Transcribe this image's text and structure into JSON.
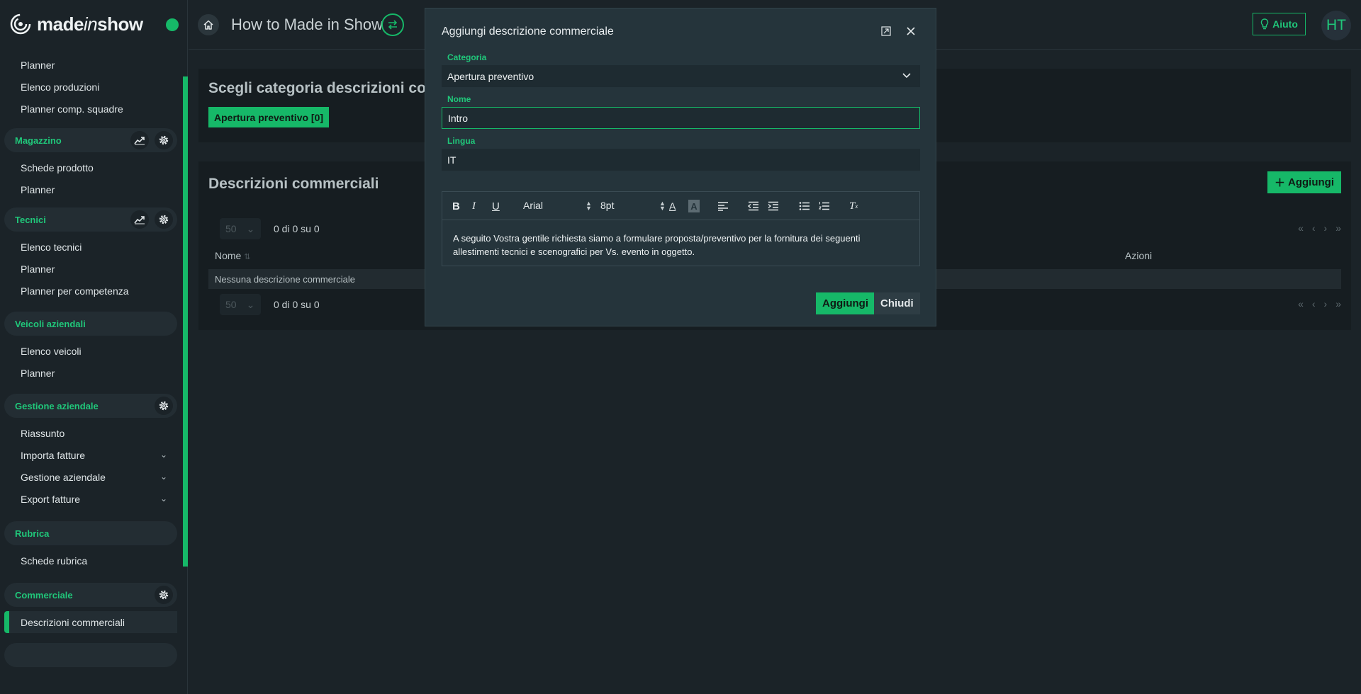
{
  "app": {
    "brand_strong": "made",
    "brand_italic": "in",
    "brand_rest": "show",
    "page_title": "How to Made in Show",
    "help_label": "Aiuto",
    "avatar_initials": "HT",
    "accent_color": "#16b868"
  },
  "sidebar": {
    "top_items": [
      "Planner",
      "Elenco produzioni",
      "Planner comp. squadre"
    ],
    "magazzino": {
      "title": "Magazzino",
      "items": [
        "Schede prodotto",
        "Planner"
      ]
    },
    "tecnici": {
      "title": "Tecnici",
      "items": [
        "Elenco tecnici",
        "Planner",
        "Planner per competenza"
      ]
    },
    "veicoli": {
      "title": "Veicoli aziendali",
      "items": [
        "Elenco veicoli",
        "Planner"
      ]
    },
    "gestione": {
      "title": "Gestione aziendale",
      "items": [
        "Riassunto",
        "Importa fatture",
        "Gestione aziendale",
        "Export fatture"
      ]
    },
    "rubrica": {
      "title": "Rubrica",
      "items": [
        "Schede rubrica"
      ]
    },
    "commerciale": {
      "title": "Commerciale",
      "items": [
        "Descrizioni commerciali"
      ]
    }
  },
  "main": {
    "category_card": {
      "title": "Scegli categoria descrizioni commerciali",
      "chip": "Apertura preventivo [0]"
    },
    "list_card": {
      "title": "Descrizioni commerciali",
      "add_label": "Aggiungi",
      "page_size": "50",
      "page_info": "0 di 0 su 0",
      "col_name": "Nome",
      "col_actions": "Azioni",
      "empty_text": "Nessuna descrizione commerciale"
    }
  },
  "modal": {
    "title": "Aggiungi descrizione commerciale",
    "category_label": "Categoria",
    "category_value": "Apertura preventivo",
    "name_label": "Nome",
    "name_value": "Intro",
    "language_label": "Lingua",
    "language_value": "IT",
    "font_family": "Arial",
    "font_size": "8pt",
    "editor_text": "A seguito Vostra gentile richiesta siamo a formulare proposta/preventivo per la fornitura dei seguenti allestimenti tecnici e scenografici per Vs. evento in oggetto.",
    "add_button": "Aggiungi",
    "close_button": "Chiudi"
  }
}
